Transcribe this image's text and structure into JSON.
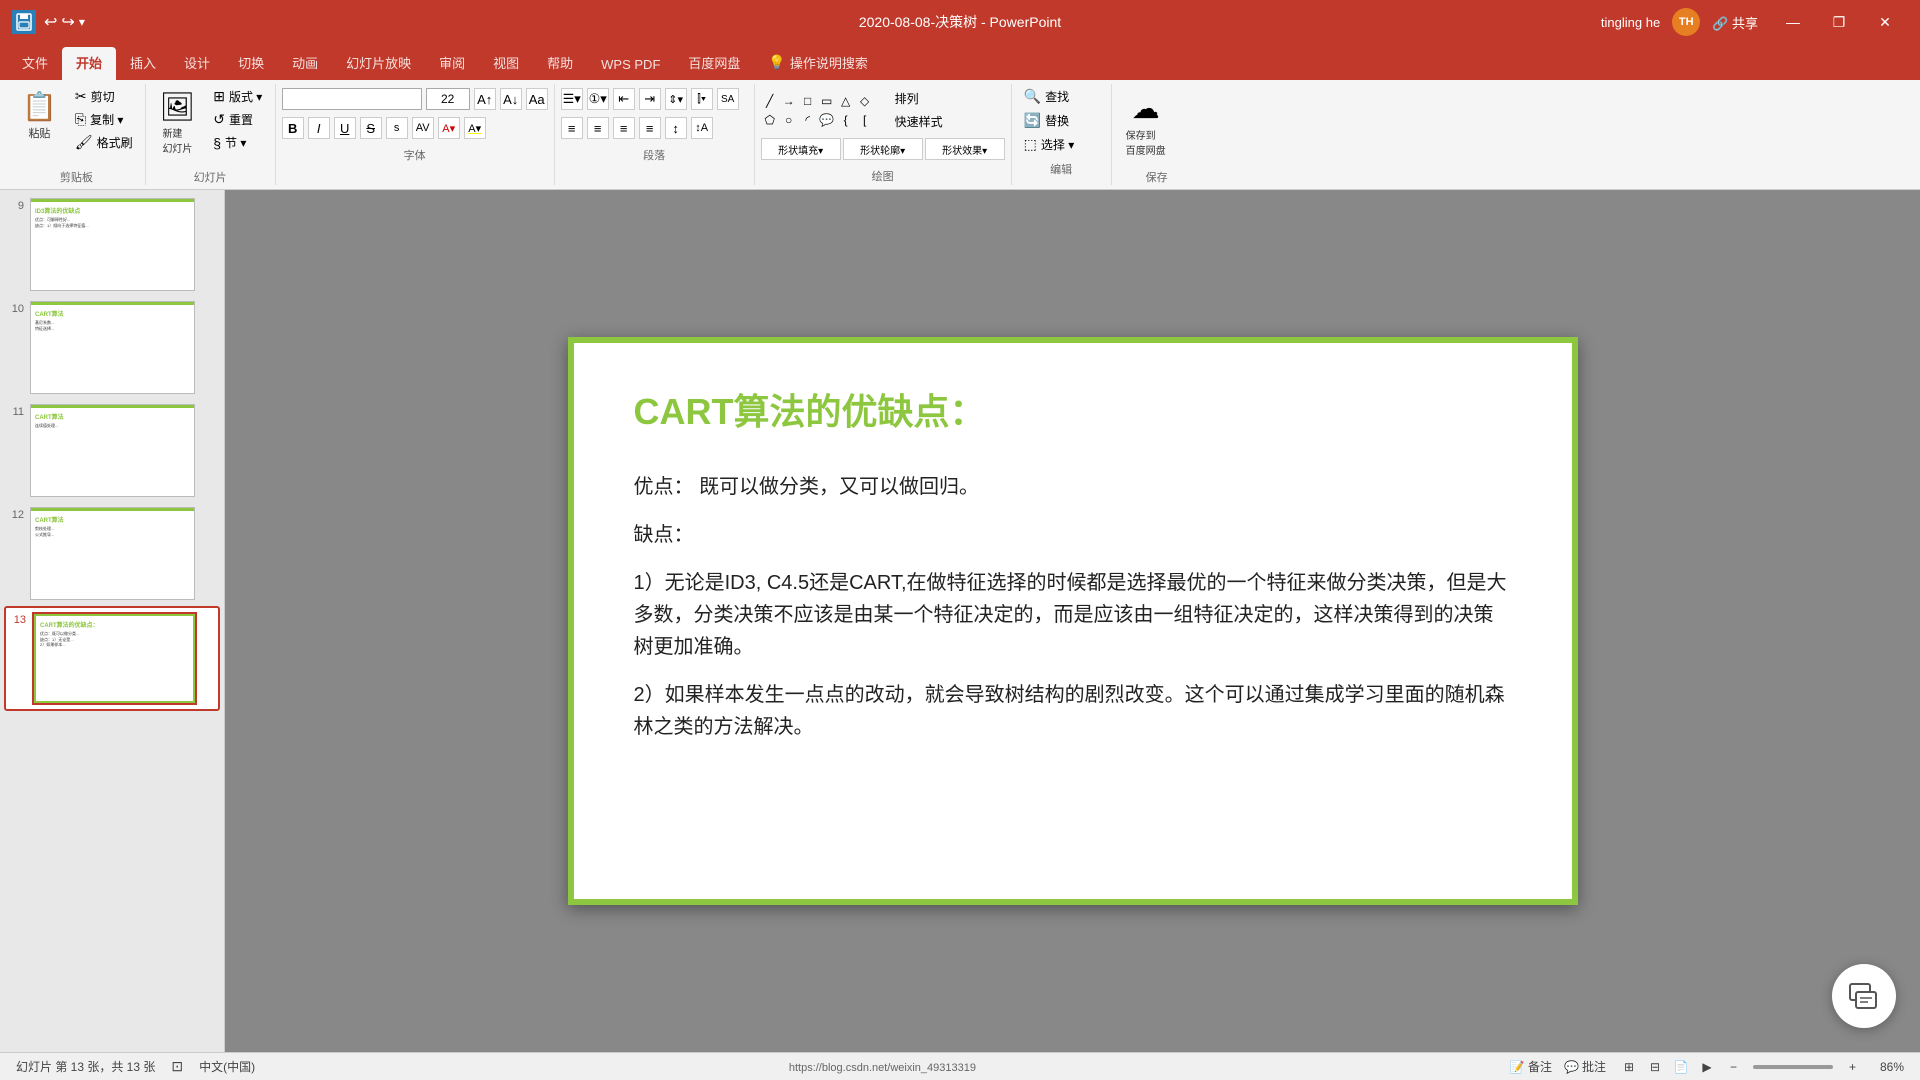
{
  "titlebar": {
    "title": "2020-08-08-决策树 - PowerPoint",
    "username": "tingling he",
    "avatar_initials": "TH",
    "minimize": "—",
    "restore": "❐",
    "close": "✕"
  },
  "ribbon_tabs": [
    {
      "id": "file",
      "label": "文件"
    },
    {
      "id": "home",
      "label": "开始",
      "active": true
    },
    {
      "id": "insert",
      "label": "插入"
    },
    {
      "id": "design",
      "label": "设计"
    },
    {
      "id": "transitions",
      "label": "切换"
    },
    {
      "id": "animations",
      "label": "动画"
    },
    {
      "id": "slideshow",
      "label": "幻灯片放映"
    },
    {
      "id": "review",
      "label": "审阅"
    },
    {
      "id": "view",
      "label": "视图"
    },
    {
      "id": "help",
      "label": "帮助"
    },
    {
      "id": "wps",
      "label": "WPS PDF"
    },
    {
      "id": "baidu",
      "label": "百度网盘"
    },
    {
      "id": "search",
      "label": "操作说明搜索"
    }
  ],
  "ribbon": {
    "clipboard": {
      "label": "剪贴板",
      "paste": "粘贴",
      "cut": "剪切",
      "copy": "复制 ▾",
      "format_painter": "格式刷"
    },
    "slides": {
      "label": "幻灯片",
      "new": "新建\n幻灯片",
      "layout": "版式 ▾",
      "reset": "重置",
      "section": "节 ▾"
    },
    "font": {
      "label": "字体",
      "font_name": "",
      "font_size": "22",
      "bold": "B",
      "italic": "I",
      "underline": "U",
      "strikethrough": "S",
      "shadow": "s",
      "grow": "A↑",
      "shrink": "A↓"
    },
    "paragraph": {
      "label": "段落"
    },
    "drawing": {
      "label": "绘图"
    },
    "edit": {
      "label": "编辑",
      "find": "查找",
      "replace": "替换",
      "select": "选择 ▾"
    },
    "save_section": {
      "label": "保存",
      "save_cloud": "保存到\n百度网盘"
    }
  },
  "slides": [
    {
      "num": "9",
      "active": false
    },
    {
      "num": "10",
      "active": false
    },
    {
      "num": "11",
      "active": false
    },
    {
      "num": "12",
      "active": false
    },
    {
      "num": "13",
      "active": true
    }
  ],
  "current_slide": {
    "title": "CART算法的优缺点：",
    "advantages_label": "优点：",
    "advantages_text": "既可以做分类，又可以做回归。",
    "disadvantages_label": "缺点：",
    "point1": "1）无论是ID3, C4.5还是CART,在做特征选择的时候都是选择最优的一个特征来做分类决策，但是大多数，分类决策不应该是由某一个特征决定的，而是应该由一组特征决定的，这样决策得到的决策树更加准确。",
    "point2": "2）如果样本发生一点点的改动，就会导致树结构的剧烈改变。这个可以通过集成学习里面的随机森林之类的方法解决。"
  },
  "statusbar": {
    "slide_info": "幻灯片 第 13 张，共 13 张",
    "language": "中文(中国)",
    "notes": "备注",
    "comments": "批注",
    "zoom": "86%",
    "url": "https://blog.csdn.net/weixin_49313319"
  }
}
